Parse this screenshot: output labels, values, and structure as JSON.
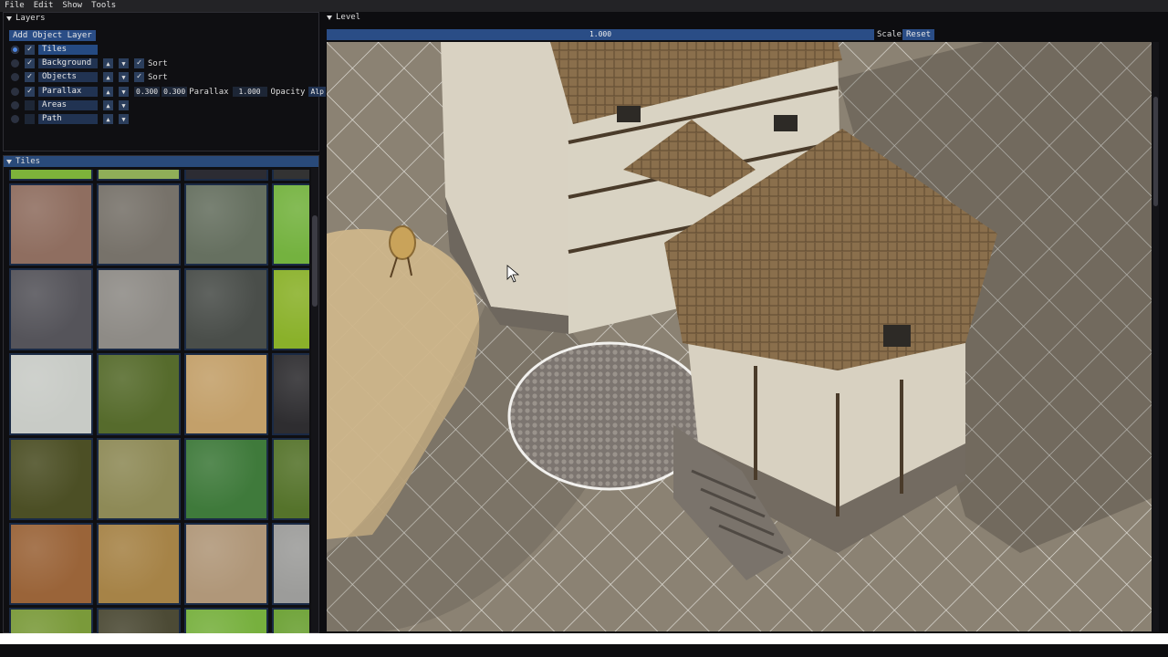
{
  "menu": [
    "File",
    "Edit",
    "Show",
    "Tools"
  ],
  "layers_panel": {
    "title": "Layers",
    "add_button": "Add Object Layer",
    "rows": [
      {
        "name": "Tiles",
        "checked": true,
        "selected": true,
        "radio": true
      },
      {
        "name": "Background",
        "checked": true,
        "sort_label": "Sort"
      },
      {
        "name": "Objects",
        "checked": true,
        "sort_label": "Sort"
      },
      {
        "name": "Parallax",
        "checked": true,
        "px": "0.300",
        "py": "0.300",
        "parallax_label": "Parallax",
        "opacity_value": "1.000",
        "opacity_label": "Opacity",
        "alpha_label": "Alp"
      },
      {
        "name": "Areas",
        "checked": false
      },
      {
        "name": "Path",
        "checked": false
      }
    ]
  },
  "tiles_panel": {
    "title": "Tiles",
    "tiles": [
      {
        "color": "#7db33a"
      },
      {
        "color": "#8fae58"
      },
      {
        "color": "#2c2c33"
      },
      {
        "color": "#333"
      },
      {
        "color": "#8f6e60"
      },
      {
        "color": "#77726a"
      },
      {
        "color": "#667060"
      },
      {
        "color": "#74b23f"
      },
      {
        "color": "#55545a"
      },
      {
        "color": "#8e8b86"
      },
      {
        "color": "#4a4e4a"
      },
      {
        "color": "#8ab12a"
      },
      {
        "color": "#c8cbc6"
      },
      {
        "color": "#566b2c"
      },
      {
        "color": "#c3a06a"
      },
      {
        "color": "#2e2d30"
      },
      {
        "color": "#4c4f25"
      },
      {
        "color": "#8e8a57"
      },
      {
        "color": "#3f7a3b"
      },
      {
        "color": "#55732b"
      },
      {
        "color": "#9a6439"
      },
      {
        "color": "#a68347"
      },
      {
        "color": "#b09779"
      },
      {
        "color": "#9c9c9a"
      },
      {
        "color": "#7a9a3a"
      },
      {
        "color": "#4c4a35"
      },
      {
        "color": "#77b03e"
      },
      {
        "color": "#6aa032"
      }
    ]
  },
  "level_panel": {
    "title": "Level",
    "scale_value": "1.000",
    "scale_label": "Scale",
    "reset_label": "Reset"
  }
}
